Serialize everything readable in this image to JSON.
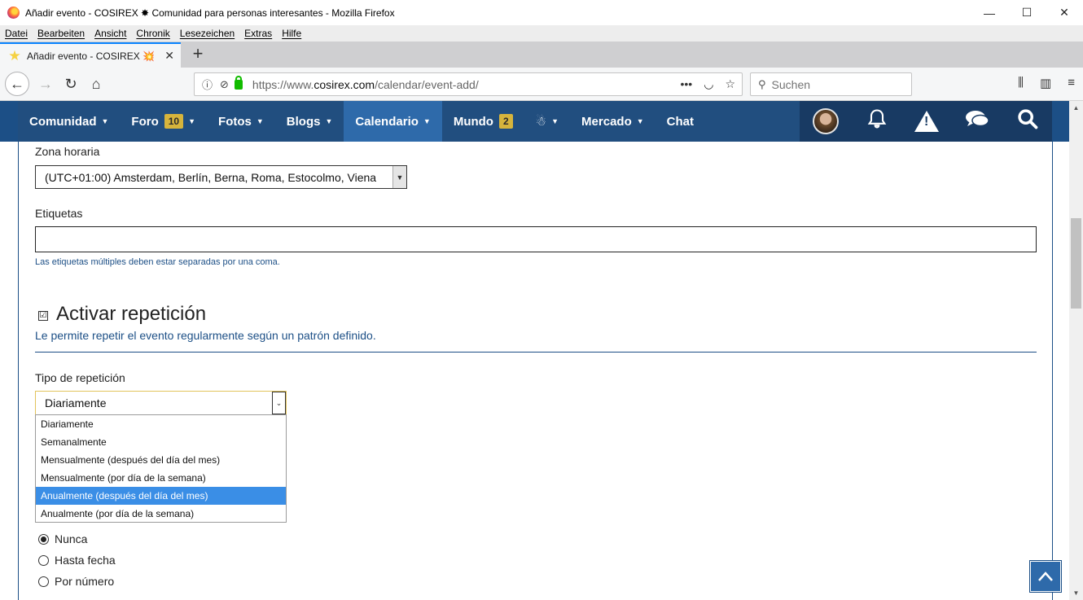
{
  "window": {
    "title": "Añadir evento - COSIREX ✸ Comunidad para personas interesantes - Mozilla Firefox",
    "minimize": "—",
    "maximize": "☐",
    "close": "✕"
  },
  "menubar": [
    "Datei",
    "Bearbeiten",
    "Ansicht",
    "Chronik",
    "Lesezeichen",
    "Extras",
    "Hilfe"
  ],
  "tab": {
    "label": "Añadir evento - COSIREX 💥 Co",
    "close": "✕",
    "new_tab": "+"
  },
  "navbar": {
    "back": "←",
    "forward": "→",
    "reload": "↻",
    "home": "⌂",
    "url_prefix": "https://www.",
    "url_domain": "cosirex.com",
    "url_path": "/calendar/event-add/",
    "page_actions": "•••",
    "pocket": "◡",
    "bookmark": "☆",
    "search_placeholder": "Suchen",
    "search_icon": "⚲",
    "library": "⫼",
    "sidebar": "▥",
    "menu": "≡"
  },
  "site_nav": {
    "items": [
      {
        "label": "Comunidad",
        "caret": "▼"
      },
      {
        "label": "Foro",
        "badge": "10",
        "caret": "▼"
      },
      {
        "label": "Fotos",
        "caret": "▼"
      },
      {
        "label": "Blogs",
        "caret": "▼"
      },
      {
        "label": "Calendario",
        "caret": "▼",
        "active": true
      },
      {
        "label": "Mundo",
        "badge": "2"
      },
      {
        "label": "☃",
        "caret": "▼"
      },
      {
        "label": "Mercado",
        "caret": "▼"
      },
      {
        "label": "Chat"
      }
    ],
    "icons": [
      "avatar",
      "bell-icon",
      "warning-icon",
      "chat-bubbles-icon",
      "search-icon"
    ],
    "bell": "🔔",
    "chat": "💬",
    "search": "⚲"
  },
  "form": {
    "timezone_label": "Zona horaria",
    "timezone_value": "(UTC+01:00) Amsterdam, Berlín, Berna, Roma, Estocolmo, Viena",
    "tags_label": "Etiquetas",
    "tags_value": "",
    "tags_help": "Las etiquetas múltiples deben estar separadas por una coma.",
    "repeat_checkbox": "☑",
    "repeat_title": "Activar repetición",
    "repeat_desc": "Le permite repetir el evento regularmente según un patrón definido.",
    "repeat_type_label": "Tipo de repetición",
    "repeat_type_value": "Diariamente",
    "repeat_type_options": [
      "Diariamente",
      "Semanalmente",
      "Mensualmente (después del día del mes)",
      "Mensualmente (por día de la semana)",
      "Anualmente (después del día del mes)",
      "Anualmente (por día de la semana)"
    ],
    "repeat_type_highlighted": 4,
    "end_options": [
      {
        "label": "Nunca",
        "checked": true
      },
      {
        "label": "Hasta fecha",
        "checked": false
      },
      {
        "label": "Por número",
        "checked": false
      }
    ]
  },
  "to_top": "︿",
  "colors": {
    "nav_bg": "#214e7f",
    "nav_active": "#2e6aaa",
    "badge": "#d6b43c",
    "link_blue": "#1c4f86",
    "option_highlight": "#3a8ee6"
  }
}
